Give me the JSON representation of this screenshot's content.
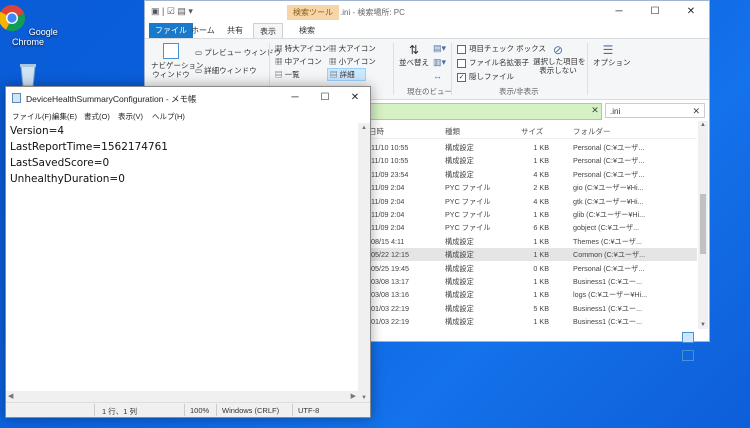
{
  "desktop": {
    "chrome_label": "Google Chrome"
  },
  "explorer": {
    "title": ".ini - 検索場所: PC",
    "context_tab": "検索ツール",
    "tabs": [
      "ファイル",
      "ホーム",
      "共有",
      "表示",
      "検索"
    ],
    "layout": {
      "extra_large": "特大アイコン",
      "large": "大アイコン",
      "medium": "中アイコン",
      "small": "小アイコン",
      "list": "一覧",
      "details": "詳細"
    },
    "pane": {
      "navigation": "ナビゲーション\nウィンドウ",
      "preview": "プレビュー ウィンドウ",
      "details": "詳細ウィンドウ"
    },
    "current_view": {
      "sort": "並べ替え",
      "group_label": "現在のビュー"
    },
    "show_hide": {
      "item_check": "項目チェック ボックス",
      "extensions": "ファイル名拡張子",
      "hidden": "隠しファイル",
      "hide_selected": "選択した項目を\n表示しない",
      "group_label": "表示/非表示"
    },
    "options": "オプション",
    "search_value": ".ini",
    "columns": [
      "日時",
      "種類",
      "サイズ",
      "フォルダー"
    ],
    "rows": [
      {
        "date": "/11/10 10:55",
        "type": "構成設定",
        "size": "1 KB",
        "folder": "Personal (C:¥ユーザ..."
      },
      {
        "date": "/11/10 10:55",
        "type": "構成設定",
        "size": "1 KB",
        "folder": "Personal (C:¥ユーザ..."
      },
      {
        "date": "/11/09 23:54",
        "type": "構成設定",
        "size": "4 KB",
        "folder": "Personal (C:¥ユーザ..."
      },
      {
        "date": "/11/09 2:04",
        "type": "PYC ファイル",
        "size": "2 KB",
        "folder": "gio (C:¥ユーザー¥Hi..."
      },
      {
        "date": "/11/09 2:04",
        "type": "PYC ファイル",
        "size": "4 KB",
        "folder": "gtk (C:¥ユーザー¥Hi..."
      },
      {
        "date": "/11/09 2:04",
        "type": "PYC ファイル",
        "size": "1 KB",
        "folder": "glib (C:¥ユーザー¥Hi..."
      },
      {
        "date": "/11/09 2:04",
        "type": "PYC ファイル",
        "size": "6 KB",
        "folder": "gobject (C:¥ユーザ..."
      },
      {
        "date": "/08/15 4:11",
        "type": "構成設定",
        "size": "1 KB",
        "folder": "Themes (C:¥ユーザ..."
      },
      {
        "date": "/05/22 12:15",
        "type": "構成設定",
        "size": "1 KB",
        "folder": "Common (C:¥ユーザ..."
      },
      {
        "date": "/05/25 19:45",
        "type": "構成設定",
        "size": "0 KB",
        "folder": "Personal (C:¥ユーザ..."
      },
      {
        "date": "/03/08 13:17",
        "type": "構成設定",
        "size": "1 KB",
        "folder": "Business1 (C:¥ユー..."
      },
      {
        "date": "/03/08 13:16",
        "type": "構成設定",
        "size": "1 KB",
        "folder": "logs (C:¥ユーザー¥Hi..."
      },
      {
        "date": "/01/03 22:19",
        "type": "構成設定",
        "size": "5 KB",
        "folder": "Business1 (C:¥ユー..."
      },
      {
        "date": "/01/03 22:19",
        "type": "構成設定",
        "size": "1 KB",
        "folder": "Business1 (C:¥ユー..."
      }
    ]
  },
  "notepad": {
    "title": "DeviceHealthSummaryConfiguration - メモ帳",
    "menu": [
      "ファイル(F)",
      "編集(E)",
      "書式(O)",
      "表示(V)",
      "ヘルプ(H)"
    ],
    "lines": [
      "Version=4",
      "LastReportTime=1562174761",
      "LastSavedScore=0",
      "UnhealthyDuration=0"
    ],
    "status": {
      "position": "1 行、1 列",
      "zoom": "100%",
      "eol": "Windows (CRLF)",
      "encoding": "UTF-8"
    }
  }
}
